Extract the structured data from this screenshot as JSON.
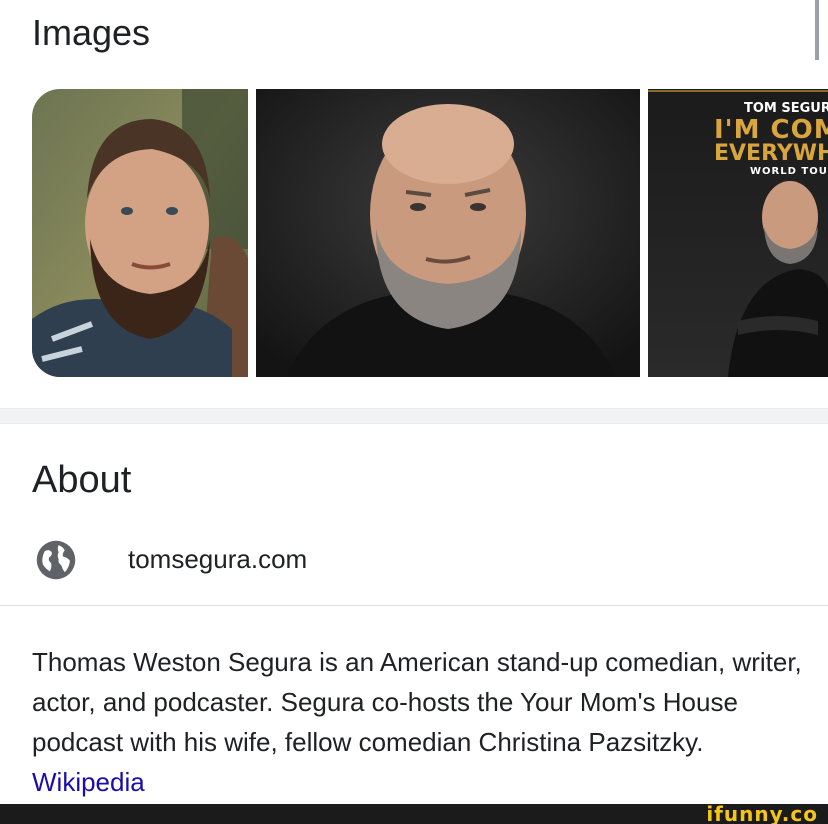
{
  "images_section": {
    "title": "Images",
    "thumbnails": [
      {
        "alt": "Tom Segura photo 1"
      },
      {
        "alt": "Tom Segura photo 2"
      },
      {
        "alt": "Tom Segura tour poster",
        "poster_name": "TOM SEGUR",
        "poster_line1": "I'M COMI",
        "poster_line2": "EVERYWHI",
        "poster_line3": "WORLD TOUI"
      }
    ]
  },
  "about_section": {
    "title": "About",
    "website": {
      "icon": "globe-icon",
      "label": "tomsegura.com"
    },
    "description": "Thomas Weston Segura is an American stand-up comedian, writer, actor, and podcaster. Segura co-hosts the Your Mom's House podcast with his wife, fellow comedian Christina Pazsitzky. ",
    "source_link": "Wikipedia"
  },
  "watermark": {
    "text": "ifunny.co"
  },
  "colors": {
    "text": "#202124",
    "link": "#1a0dab",
    "divider": "#dadce0",
    "watermark": "#f5c518"
  }
}
